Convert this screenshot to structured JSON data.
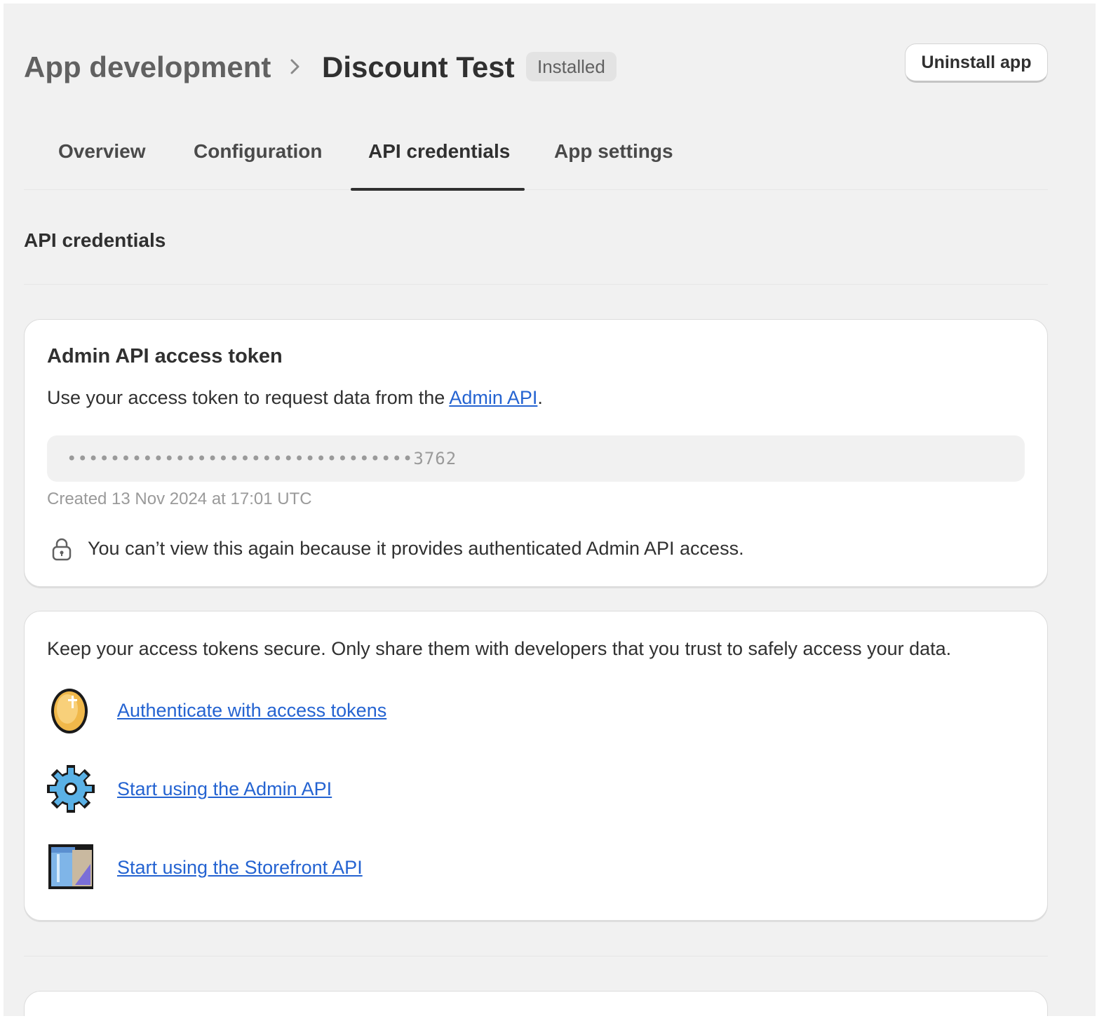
{
  "header": {
    "breadcrumb_parent": "App development",
    "title": "Discount Test",
    "status_badge": "Installed",
    "uninstall_label": "Uninstall app"
  },
  "tabs": [
    {
      "label": "Overview",
      "active": false
    },
    {
      "label": "Configuration",
      "active": false
    },
    {
      "label": "API credentials",
      "active": true
    },
    {
      "label": "App settings",
      "active": false
    }
  ],
  "section": {
    "title": "API credentials"
  },
  "token_card": {
    "title": "Admin API access token",
    "desc_prefix": "Use your access token to request data from the ",
    "desc_link": "Admin API",
    "desc_suffix": ".",
    "token_value": "••••••••••••••••••••••••••••••••3762",
    "created": "Created 13 Nov 2024 at 17:01 UTC",
    "lock_note": "You can’t view this again because it provides authenticated Admin API access."
  },
  "links_card": {
    "intro": "Keep your access tokens secure. Only share them with developers that you trust to safely access your data.",
    "links": [
      {
        "label": "Authenticate with access tokens",
        "icon": "coin-icon"
      },
      {
        "label": "Start using the Admin API",
        "icon": "gear-icon"
      },
      {
        "label": "Start using the Storefront API",
        "icon": "storefront-icon"
      }
    ]
  },
  "colors": {
    "page_bg": "#f1f1f1",
    "link": "#2463d1",
    "text": "#303030",
    "muted": "#9a9a9a"
  }
}
